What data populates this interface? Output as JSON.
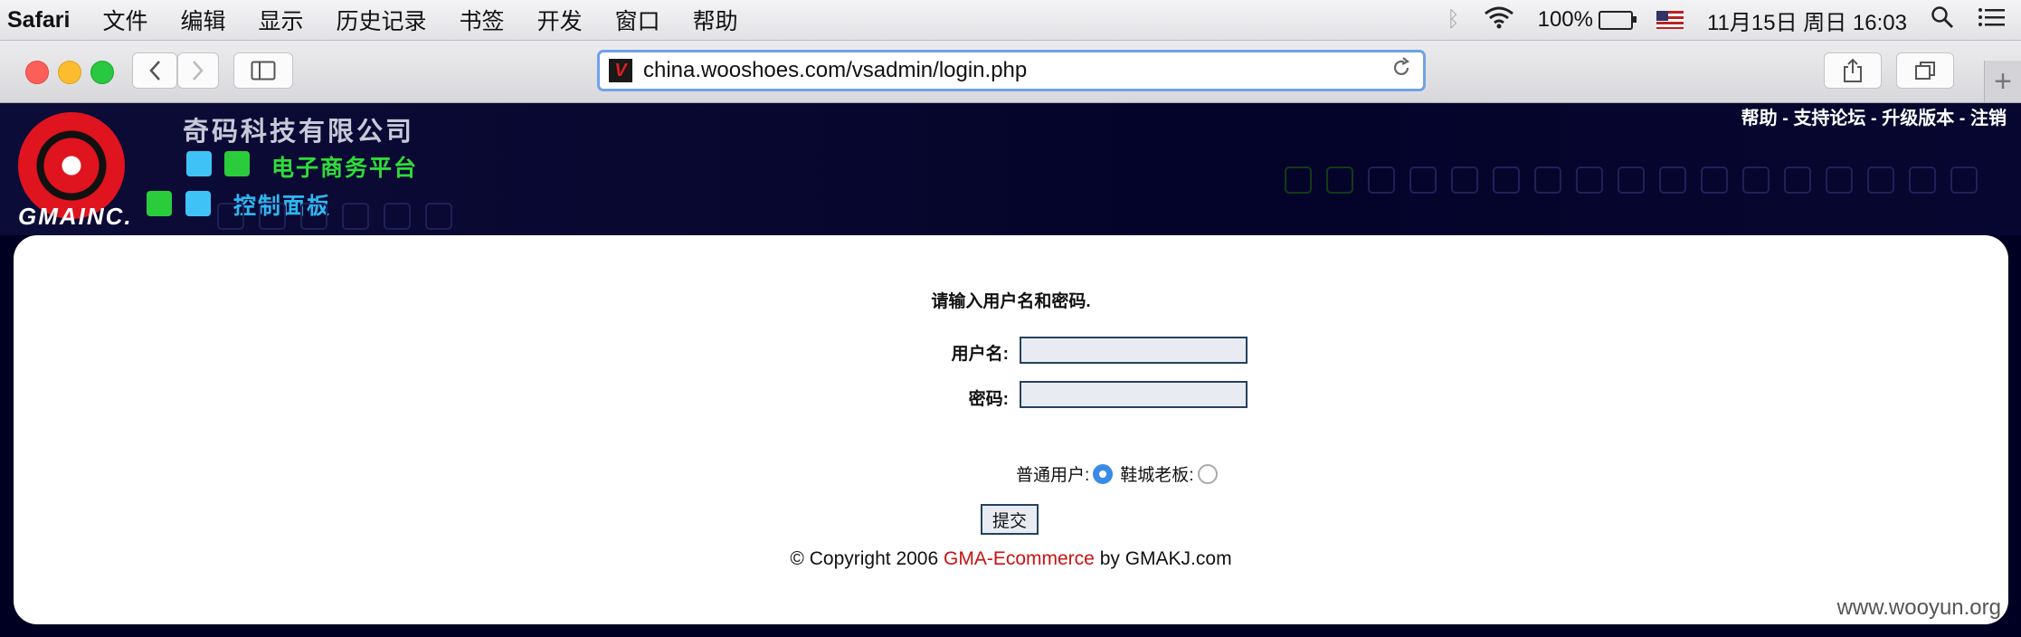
{
  "menubar": {
    "app": "Safari",
    "menus": [
      "文件",
      "编辑",
      "显示",
      "历史记录",
      "书签",
      "开发",
      "窗口",
      "帮助"
    ],
    "battery": "100%",
    "datetime": "11月15日 周日  16:03"
  },
  "browser": {
    "url": "china.wooshoes.com/vsadmin/login.php"
  },
  "header": {
    "logo_text": "GMAINC.",
    "company": "奇码科技有限公司",
    "platform": "电子商务平台",
    "control_panel": "控制面板",
    "links": [
      "帮助",
      "支持论坛",
      "升级版本",
      "注销"
    ],
    "link_separator": " - "
  },
  "login": {
    "prompt": "请输入用户名和密码.",
    "username_label": "用户名:",
    "password_label": "密码:",
    "username_value": "",
    "password_value": "",
    "role_normal": "普通用户:",
    "role_boss": "鞋城老板:",
    "selected_role": "普通用户",
    "submit_label": "提交"
  },
  "footer": {
    "copyright_prefix": "© Copyright 2006 ",
    "brand": "GMA-Ecommerce",
    "copyright_suffix": " by GMAKJ.com"
  },
  "watermark": "www.wooyun.org",
  "colors": {
    "header_bg": "#04042a",
    "brand_red": "#cc1111",
    "platform_green": "#2fdc3a",
    "panel_blue": "#2cb8f2",
    "radio_selected": "#3a8be8"
  }
}
